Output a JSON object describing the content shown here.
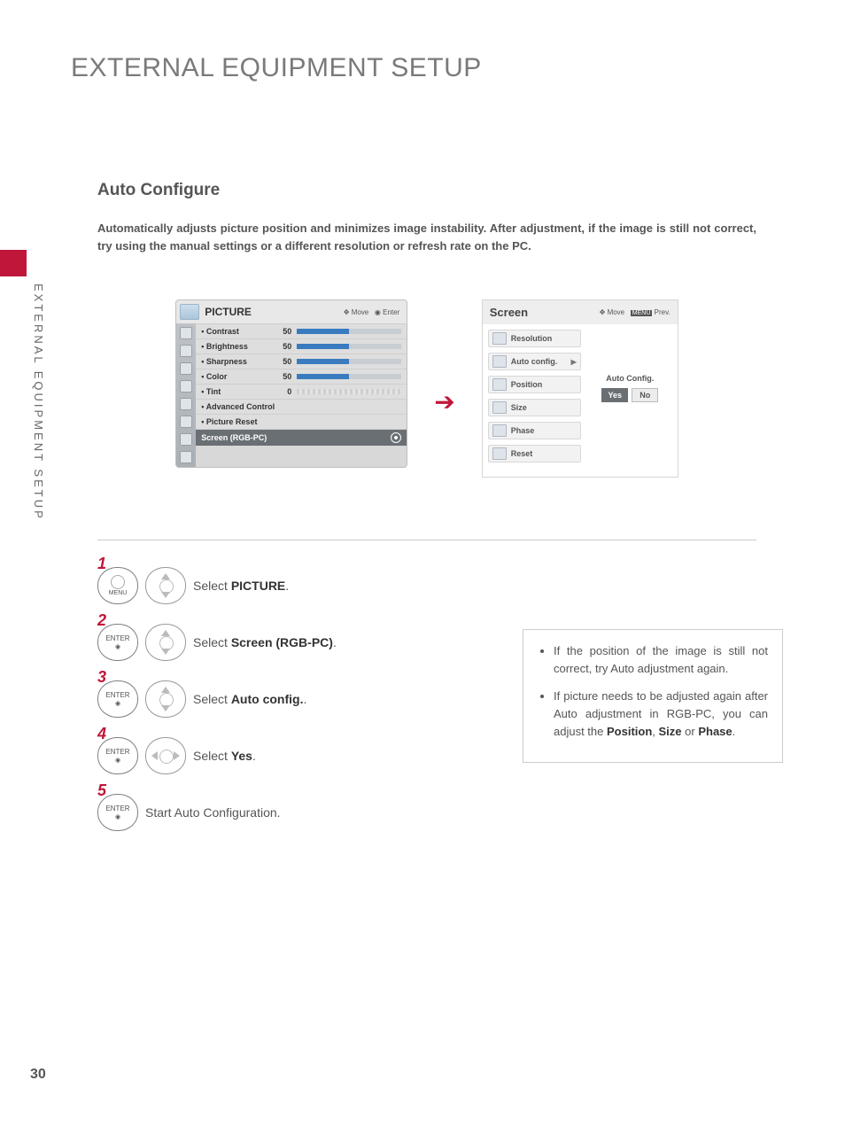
{
  "page_number": "30",
  "side_label": "EXTERNAL EQUIPMENT SETUP",
  "title": "EXTERNAL EQUIPMENT SETUP",
  "section": "Auto Configure",
  "intro": "Automatically adjusts picture position and minimizes image instability. After adjustment, if the image is still not correct, try using the manual settings or a different resolution or refresh rate on the PC.",
  "picture": {
    "title": "PICTURE",
    "hint_move": "Move",
    "hint_enter": "Enter",
    "items": [
      {
        "label": "• Contrast",
        "value": "50"
      },
      {
        "label": "• Brightness",
        "value": "50"
      },
      {
        "label": "• Sharpness",
        "value": "50"
      },
      {
        "label": "• Color",
        "value": "50"
      },
      {
        "label": "• Tint",
        "value": "0"
      },
      {
        "label": "• Advanced Control",
        "value": ""
      },
      {
        "label": "• Picture Reset",
        "value": ""
      }
    ],
    "selected": "Screen (RGB-PC)"
  },
  "screen": {
    "title": "Screen",
    "hint_move": "Move",
    "hint_prev": "Prev.",
    "prev_btn": "MENU",
    "items": {
      "resolution": "Resolution",
      "autoconfig": "Auto config.",
      "position": "Position",
      "size": "Size",
      "phase": "Phase",
      "reset": "Reset"
    },
    "ac_label": "Auto Config.",
    "yes": "Yes",
    "no": "No"
  },
  "steps": {
    "s1": {
      "num": "1",
      "btn": "MENU",
      "text_a": "Select ",
      "text_b": "PICTURE",
      "text_c": "."
    },
    "s2": {
      "num": "2",
      "btn": "ENTER",
      "text_a": "Select ",
      "text_b": "Screen (RGB-PC)",
      "text_c": "."
    },
    "s3": {
      "num": "3",
      "btn": "ENTER",
      "text_a": "Select ",
      "text_b": "Auto config.",
      "text_c": "."
    },
    "s4": {
      "num": "4",
      "btn": "ENTER",
      "text_a": "Select ",
      "text_b": "Yes",
      "text_c": "."
    },
    "s5": {
      "num": "5",
      "btn": "ENTER",
      "text": "Start Auto Configuration."
    }
  },
  "notes": {
    "n1": "If the position of the image is still not correct, try Auto adjustment again.",
    "n2a": "If picture needs to be adjusted again after Auto adjustment in RGB-PC, you can adjust the ",
    "n2b": "Position",
    "n2c": ", ",
    "n2d": "Size",
    "n2e": " or ",
    "n2f": "Phase",
    "n2g": "."
  }
}
